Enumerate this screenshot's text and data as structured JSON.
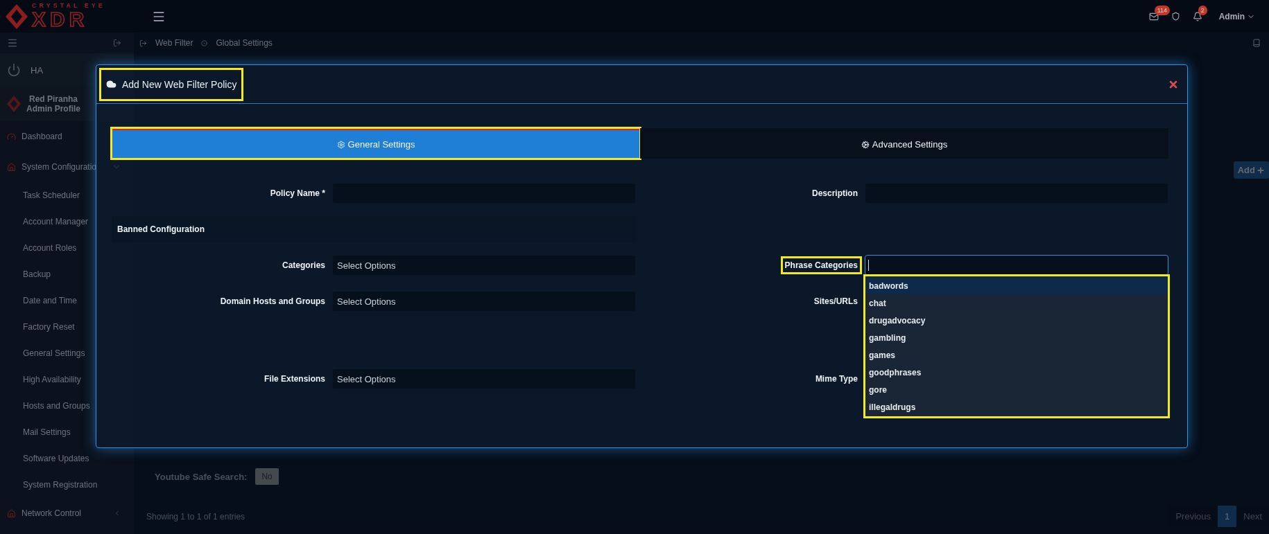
{
  "topbar": {
    "logo_top": "CRYSTAL EYE",
    "logo_main": "XDR",
    "mail_badge": "114",
    "bell_badge": "2",
    "user": "Admin"
  },
  "breadcrumb": [
    "Web Filter",
    "Global Settings"
  ],
  "sidebar": {
    "ha": "HA",
    "profile": {
      "name": "Red Piranha",
      "role": "Admin Profile"
    },
    "sections": [
      {
        "label": "Dashboard",
        "kind": "link"
      },
      {
        "label": "System Configuratio",
        "kind": "group",
        "expanded": true,
        "children": [
          "Task Scheduler",
          "Account Manager",
          "Account Roles",
          "Backup",
          "Date and Time",
          "Factory Reset",
          "General Settings",
          "High Availability",
          "Hosts and Groups",
          "Mail Settings",
          "Software Updates",
          "System Registration"
        ]
      },
      {
        "label": "Network Control",
        "kind": "group",
        "expanded": false
      }
    ]
  },
  "main": {
    "add_button": "Add",
    "youtube_safe_search": {
      "label": "Youtube Safe Search:",
      "value": "No"
    },
    "table_info": "Showing 1 to 1 of 1 entries",
    "pagination": [
      {
        "label": "Previous",
        "selected": false
      },
      {
        "label": "1",
        "selected": true
      },
      {
        "label": "Next",
        "selected": false
      }
    ]
  },
  "modal": {
    "title": {
      "text": "Add New Web Filter Policy",
      "highlighted": true
    },
    "tabs": [
      {
        "label": "General Settings",
        "selected": true,
        "highlighted": true
      },
      {
        "label": "Advanced Settings",
        "selected": false,
        "highlighted": false
      }
    ],
    "left": [
      {
        "kind": "text",
        "label": "Policy Name *"
      },
      {
        "kind": "section",
        "label": "Banned Configuration"
      },
      {
        "kind": "select",
        "label": "Categories",
        "placeholder": "Select Options"
      },
      {
        "kind": "select",
        "label": "Domain Hosts and Groups",
        "placeholder": "Select Options"
      },
      {
        "kind": "select",
        "label": "File Extensions",
        "placeholder": "Select Options"
      }
    ],
    "right": [
      {
        "kind": "text",
        "label": "Description"
      },
      {
        "kind": "open-select",
        "label": "Phrase Categories",
        "highlighted": true
      },
      {
        "kind": "label-only",
        "label": "Sites/URLs"
      },
      {
        "kind": "label-only",
        "label": "Mime Type"
      }
    ],
    "dropdown": {
      "highlighted": true,
      "options": [
        {
          "label": "badwords",
          "selected": true
        },
        {
          "label": "chat",
          "selected": false
        },
        {
          "label": "drugadvocacy",
          "selected": false
        },
        {
          "label": "gambling",
          "selected": false
        },
        {
          "label": "games",
          "selected": false
        },
        {
          "label": "goodphrases",
          "selected": false
        },
        {
          "label": "gore",
          "selected": false
        },
        {
          "label": "illegaldrugs",
          "selected": false
        }
      ]
    }
  }
}
